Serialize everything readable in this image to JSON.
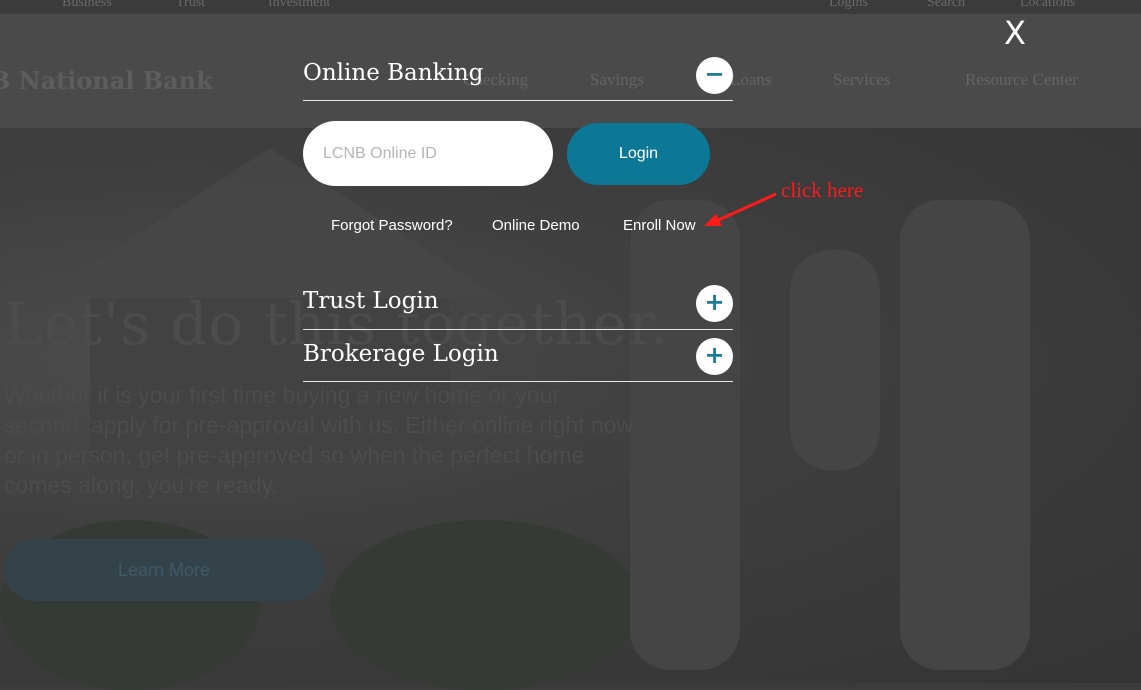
{
  "site": {
    "topbar": {
      "business": "Business",
      "trust": "Trust",
      "investment": "Investment",
      "logins": "Logins",
      "search": "Search",
      "locations": "Locations"
    },
    "bank_name": "B National Bank",
    "nav": {
      "checking": "Checking",
      "savings": "Savings",
      "loans": "Loans",
      "services": "Services",
      "resource_center": "Resource Center"
    },
    "hero": {
      "title": "Let's do this together.",
      "text": "Whether it is your first time buying a new home or your second, apply for pre-approval with us. Either online right now or in person, get pre-approved so when the perfect home comes along, you're ready.",
      "button": "Learn More"
    }
  },
  "modal": {
    "close": "X",
    "online_banking": {
      "title": "Online Banking",
      "toggle": "−",
      "id_placeholder": "LCNB Online ID",
      "login_button": "Login",
      "links": {
        "forgot_password": "Forgot Password?",
        "online_demo": "Online Demo",
        "enroll_now": "Enroll Now"
      }
    },
    "trust": {
      "title": "Trust Login",
      "toggle": "+"
    },
    "brokerage": {
      "title": "Brokerage Login",
      "toggle": "+"
    }
  },
  "annotation": {
    "text": "click here",
    "color": "#ff1a1a"
  },
  "colors": {
    "accent": "#0d7896",
    "overlay": "#3b3b3b"
  }
}
